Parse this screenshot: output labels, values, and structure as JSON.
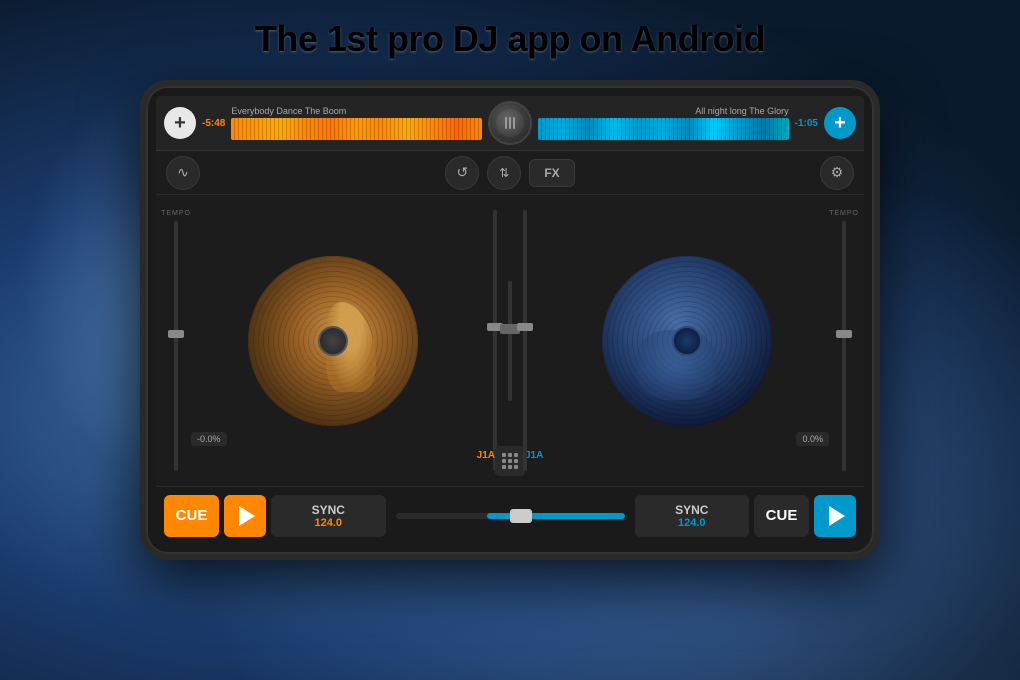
{
  "headline": "The 1st pro DJ app on Android",
  "app": {
    "deck_left": {
      "time": "-5:48",
      "track_name": "Everybody Dance  The Boom",
      "bpm": "124.0",
      "pitch": "-0.0%",
      "tempo_label": "TEMPO",
      "track_id": "J1A",
      "cue_label": "CUE",
      "sync_label": "SYNC",
      "play_label": "▶"
    },
    "deck_right": {
      "time": "-1:05",
      "track_name": "All night long  The Glory",
      "bpm": "124.0",
      "pitch": "0.0%",
      "tempo_label": "TEMPO",
      "track_id": "J1A",
      "cue_label": "CUE",
      "sync_label": "SYNC",
      "play_label": "▶"
    },
    "controls": {
      "wave_btn": "∿",
      "loop_btn": "↺",
      "eq_btn": "⇅",
      "fx_btn": "FX",
      "settings_btn": "⚙"
    }
  }
}
